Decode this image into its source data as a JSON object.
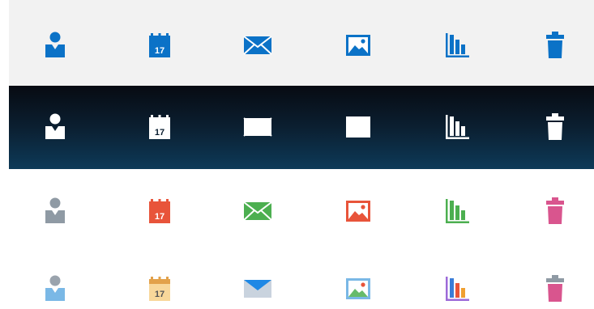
{
  "icon_set": {
    "columns": [
      {
        "icon": "user-icon"
      },
      {
        "icon": "calendar-icon"
      },
      {
        "icon": "mail-icon"
      },
      {
        "icon": "image-icon"
      },
      {
        "icon": "bar-chart-icon"
      },
      {
        "icon": "trash-icon"
      }
    ],
    "calendar_day": "17",
    "rows": [
      {
        "name": "blue-on-light",
        "background": "#f2f2f2",
        "colors": {
          "user": "#0b72c7",
          "calendar": "#0b72c7",
          "mail": "#0b72c7",
          "image": "#0b72c7",
          "chart": "#0b72c7",
          "trash": "#0b72c7"
        }
      },
      {
        "name": "white-on-dark",
        "background_top": "#070b12",
        "background_bottom": "#0d3a58",
        "colors": {
          "user": "#ffffff",
          "calendar": "#ffffff",
          "mail": "#ffffff",
          "image": "#ffffff",
          "chart": "#ffffff",
          "trash": "#ffffff"
        }
      },
      {
        "name": "single-color",
        "background": "#ffffff",
        "colors": {
          "user": "#8f9aa4",
          "calendar": "#e8543a",
          "mail": "#4caf50",
          "image": "#e8543a",
          "chart": "#4caf50",
          "trash": "#d9558e"
        }
      },
      {
        "name": "multi-color",
        "background": "#ffffff",
        "colors": {
          "user_head": "#9aa3ad",
          "user_body": "#7ab8e6",
          "calendar_top": "#e2a14a",
          "calendar_body": "#f8d79a",
          "calendar_text": "#555555",
          "mail_flap": "#1e88e5",
          "mail_body": "#c9d3de",
          "image_frame": "#7ab8e6",
          "image_hill": "#66bb6a",
          "image_sun": "#e8543a",
          "chart_bar1": "#3b7dd8",
          "chart_bar2": "#e8543a",
          "chart_bar3": "#f0a030",
          "chart_axis": "#9c6ad8",
          "trash_lid": "#8f9aa4",
          "trash_body": "#d9558e"
        }
      }
    ]
  }
}
